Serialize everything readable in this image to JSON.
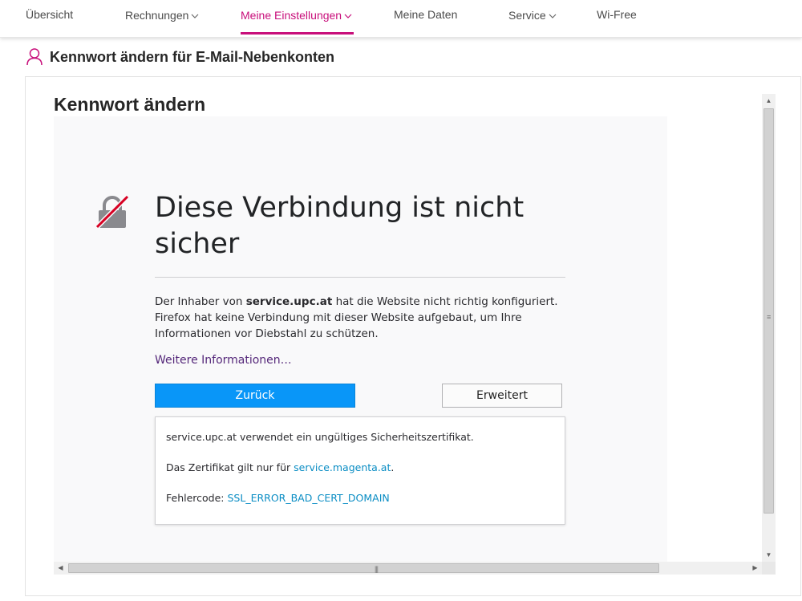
{
  "nav": {
    "items": [
      {
        "label": "Übersicht"
      },
      {
        "label": "Rechnungen"
      },
      {
        "label": "Meine Einstellungen"
      },
      {
        "label": "Meine Daten"
      },
      {
        "label": "Service"
      },
      {
        "label": "Wi-Free"
      }
    ],
    "chevron": "∨",
    "active_color": "#c80f7b"
  },
  "page": {
    "heading": "Kennwort ändern für E-Mail-Nebenkonten",
    "heading_icon": "user-icon",
    "section_title": "Kennwort ändern"
  },
  "error_page": {
    "icon": "broken-lock-icon",
    "title": "Diese Verbindung ist nicht sicher",
    "desc_prefix": "Der Inhaber von ",
    "desc_host": "service.upc.at",
    "desc_suffix": " hat die Website nicht richtig konfiguriert. Firefox hat keine Verbindung mit dieser Website aufgebaut, um Ihre Informationen vor Diebstahl zu schützen.",
    "more_info": "Weitere Informationen…",
    "back_button": "Zurück",
    "advanced_button": "Erweitert",
    "advanced_panel": {
      "line1": "service.upc.at verwendet ein ungültiges Sicherheitszertifikat.",
      "line2_prefix": "Das Zertifikat gilt nur für ",
      "line2_link": "service.magenta.at",
      "line2_suffix": ".",
      "line3_prefix": "Fehlercode: ",
      "line3_code": "SSL_ERROR_BAD_CERT_DOMAIN"
    },
    "primary_color": "#0996f8",
    "link_color": "#0a8dc4"
  }
}
